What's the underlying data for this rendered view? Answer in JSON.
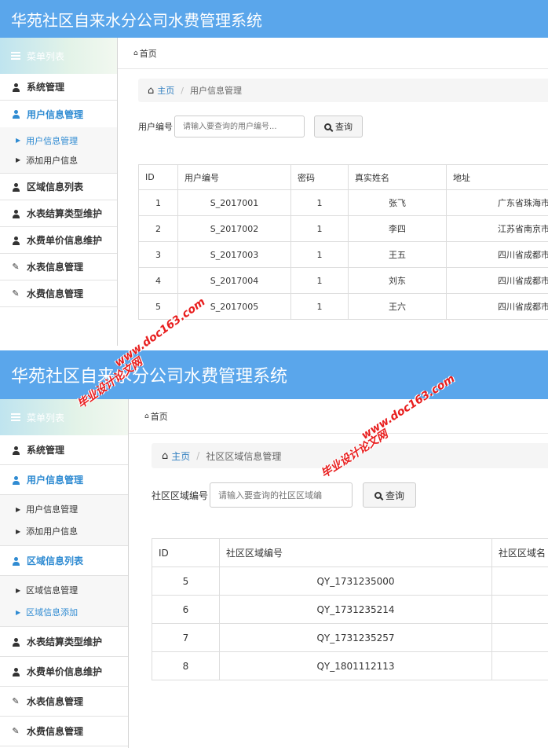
{
  "app_title": "华苑社区自来水分公司水费管理系统",
  "sidebar_header": "菜单列表",
  "menu": {
    "system": "系统管理",
    "user_info": "用户信息管理",
    "user_info_sub": "用户信息管理",
    "add_user": "添加用户信息",
    "region_list": "区域信息列表",
    "region_manage": "区域信息管理",
    "region_add": "区域信息添加",
    "meter_settle": "水表结算类型维护",
    "price": "水费单价信息维护",
    "meter_info": "水表信息管理",
    "fee_info": "水费信息管理"
  },
  "topnav_home": "首页",
  "breadcrumb": {
    "home": "主页",
    "page1": "用户信息管理",
    "page2": "社区区域信息管理"
  },
  "search1": {
    "label": "用户编号",
    "placeholder": "请输入要查询的用户编号...",
    "button": "查询"
  },
  "search2": {
    "label": "社区区域编号",
    "placeholder": "请输入要查询的社区区域编",
    "button": "查询"
  },
  "table1": {
    "headers": [
      "ID",
      "用户编号",
      "密码",
      "真实姓名",
      "地址"
    ],
    "rows": [
      [
        "1",
        "S_2017001",
        "1",
        "张飞",
        "广东省珠海市"
      ],
      [
        "2",
        "S_2017002",
        "1",
        "李四",
        "江苏省南京市"
      ],
      [
        "3",
        "S_2017003",
        "1",
        "王五",
        "四川省成都市"
      ],
      [
        "4",
        "S_2017004",
        "1",
        "刘东",
        "四川省成都市"
      ],
      [
        "5",
        "S_2017005",
        "1",
        "王六",
        "四川省成都市"
      ]
    ]
  },
  "table2": {
    "headers": [
      "ID",
      "社区区域编号",
      "社区区域名"
    ],
    "rows": [
      [
        "5",
        "QY_1731235000",
        ""
      ],
      [
        "6",
        "QY_1731235214",
        ""
      ],
      [
        "7",
        "QY_1731235257",
        ""
      ],
      [
        "8",
        "QY_1801112113",
        ""
      ]
    ]
  },
  "watermark": {
    "url": "www.doc163.com",
    "site": "毕业设计论文网"
  },
  "colors": {
    "topbar": "#5aa6eb",
    "active": "#2f8bd2",
    "link": "#2f7ec0",
    "watermark": "#e81e1e"
  }
}
